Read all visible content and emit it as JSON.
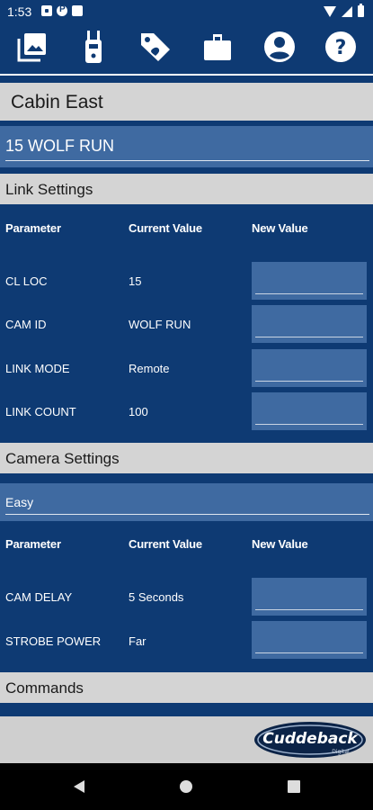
{
  "status_bar": {
    "time": "1:53"
  },
  "toolbar": {
    "icons": [
      "gallery-icon",
      "remote-icon",
      "tag-icon",
      "briefcase-icon",
      "account-icon",
      "help-icon"
    ]
  },
  "camera": {
    "name": "Cabin East",
    "location_field": "15 WOLF RUN"
  },
  "link_settings": {
    "title": "Link Settings",
    "headers": {
      "parameter": "Parameter",
      "current": "Current Value",
      "new": "New Value"
    },
    "rows": [
      {
        "parameter": "CL LOC",
        "current": "15"
      },
      {
        "parameter": "CAM ID",
        "current": "WOLF RUN"
      },
      {
        "parameter": "LINK MODE",
        "current": "Remote"
      },
      {
        "parameter": "LINK COUNT",
        "current": "100"
      }
    ]
  },
  "camera_settings": {
    "title": "Camera Settings",
    "mode": "Easy",
    "headers": {
      "parameter": "Parameter",
      "current": "Current Value",
      "new": "New Value"
    },
    "rows": [
      {
        "parameter": "CAM DELAY",
        "current": "5 Seconds"
      },
      {
        "parameter": "STROBE POWER",
        "current": "Far"
      }
    ]
  },
  "commands": {
    "title": "Commands"
  },
  "footer": {
    "brand": "Cuddeback",
    "brand_sub": "Digital"
  },
  "colors": {
    "primary": "#0e3a73",
    "field": "#3f6aa1",
    "section": "#d4d4d4"
  }
}
